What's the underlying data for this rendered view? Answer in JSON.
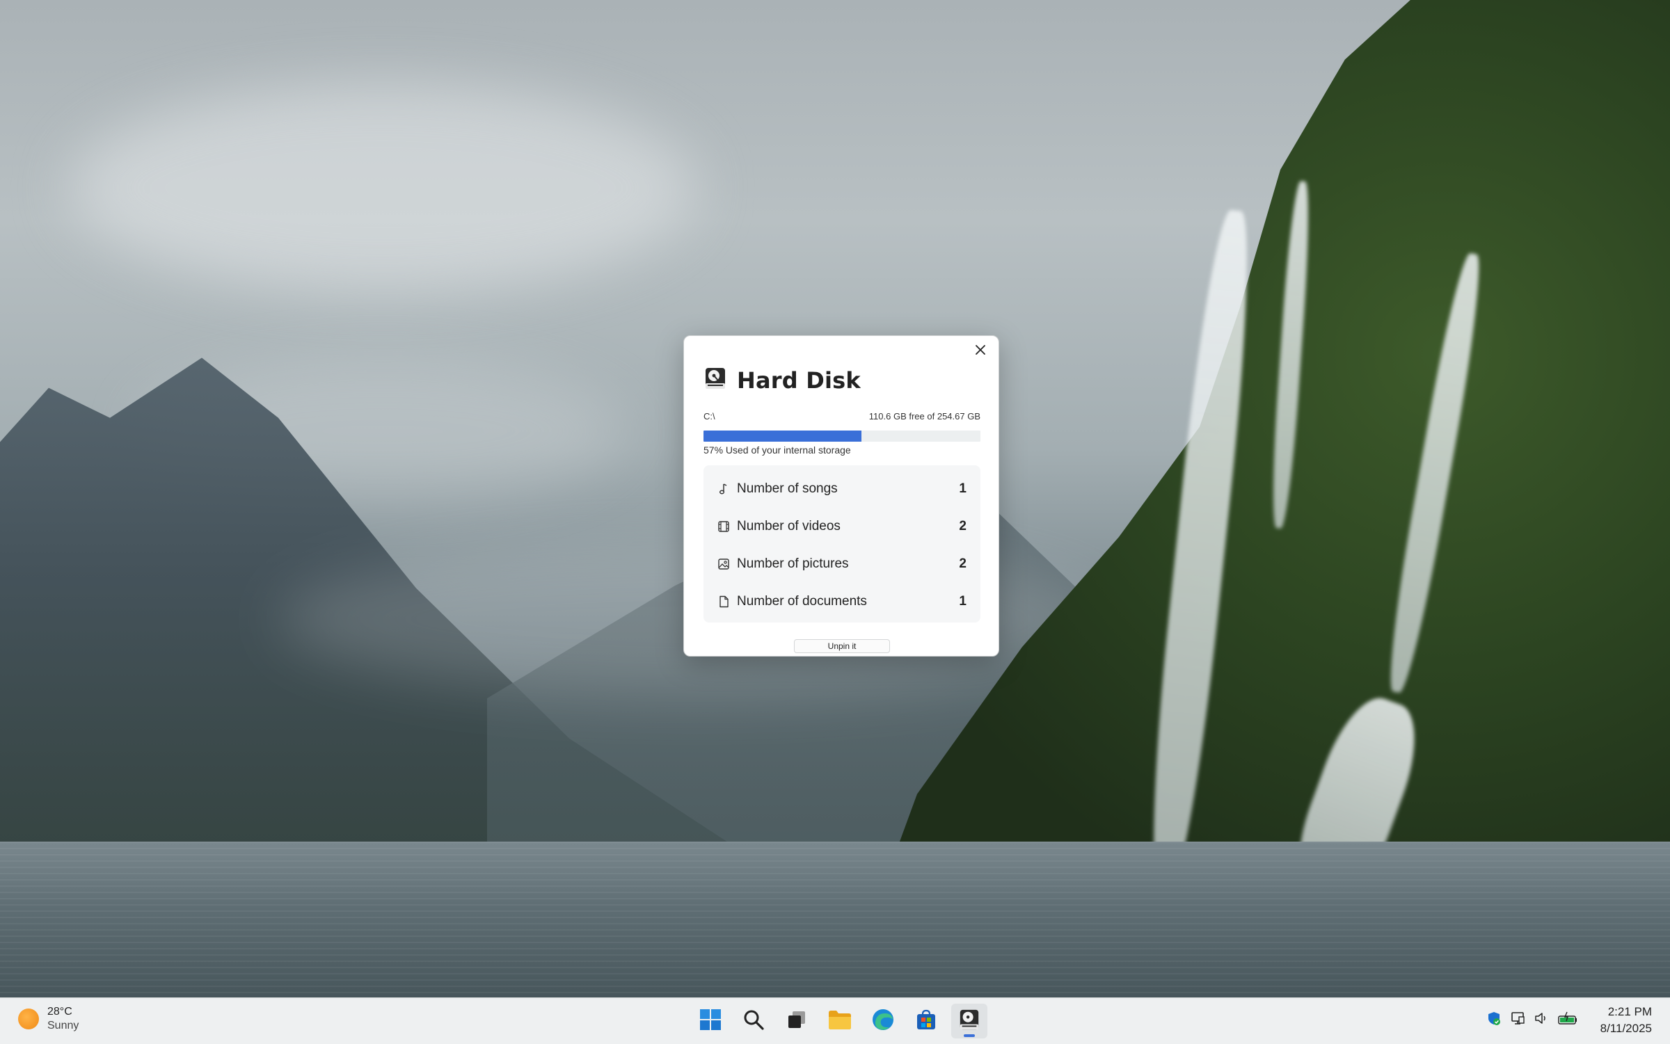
{
  "widget": {
    "title": "Hard Disk",
    "drive": "C:\\",
    "free_text": "110.6 GB free of 254.67 GB",
    "used_fraction": 0.57,
    "used_text": "57% Used of your internal storage",
    "stats": [
      {
        "label": "Number of songs",
        "value": "1",
        "icon": "music-note-icon"
      },
      {
        "label": "Number of videos",
        "value": "2",
        "icon": "film-icon"
      },
      {
        "label": "Number of pictures",
        "value": "2",
        "icon": "image-icon"
      },
      {
        "label": "Number of documents",
        "value": "1",
        "icon": "document-icon"
      }
    ],
    "unpin_label": "Unpin it",
    "accent_color": "#3a6fd8"
  },
  "taskbar": {
    "weather": {
      "temp": "28°C",
      "condition": "Sunny",
      "icon": "sun-icon"
    },
    "apps": [
      "windows-start-icon",
      "search-icon",
      "task-view-icon",
      "file-explorer-icon",
      "edge-browser-icon",
      "microsoft-store-icon",
      "hard-disk-app-icon"
    ],
    "tray_icons": [
      "security-shield-icon",
      "network-icon",
      "volume-icon",
      "battery-icon"
    ],
    "clock": {
      "time": "2:21 PM",
      "date": "8/11/2025"
    }
  }
}
